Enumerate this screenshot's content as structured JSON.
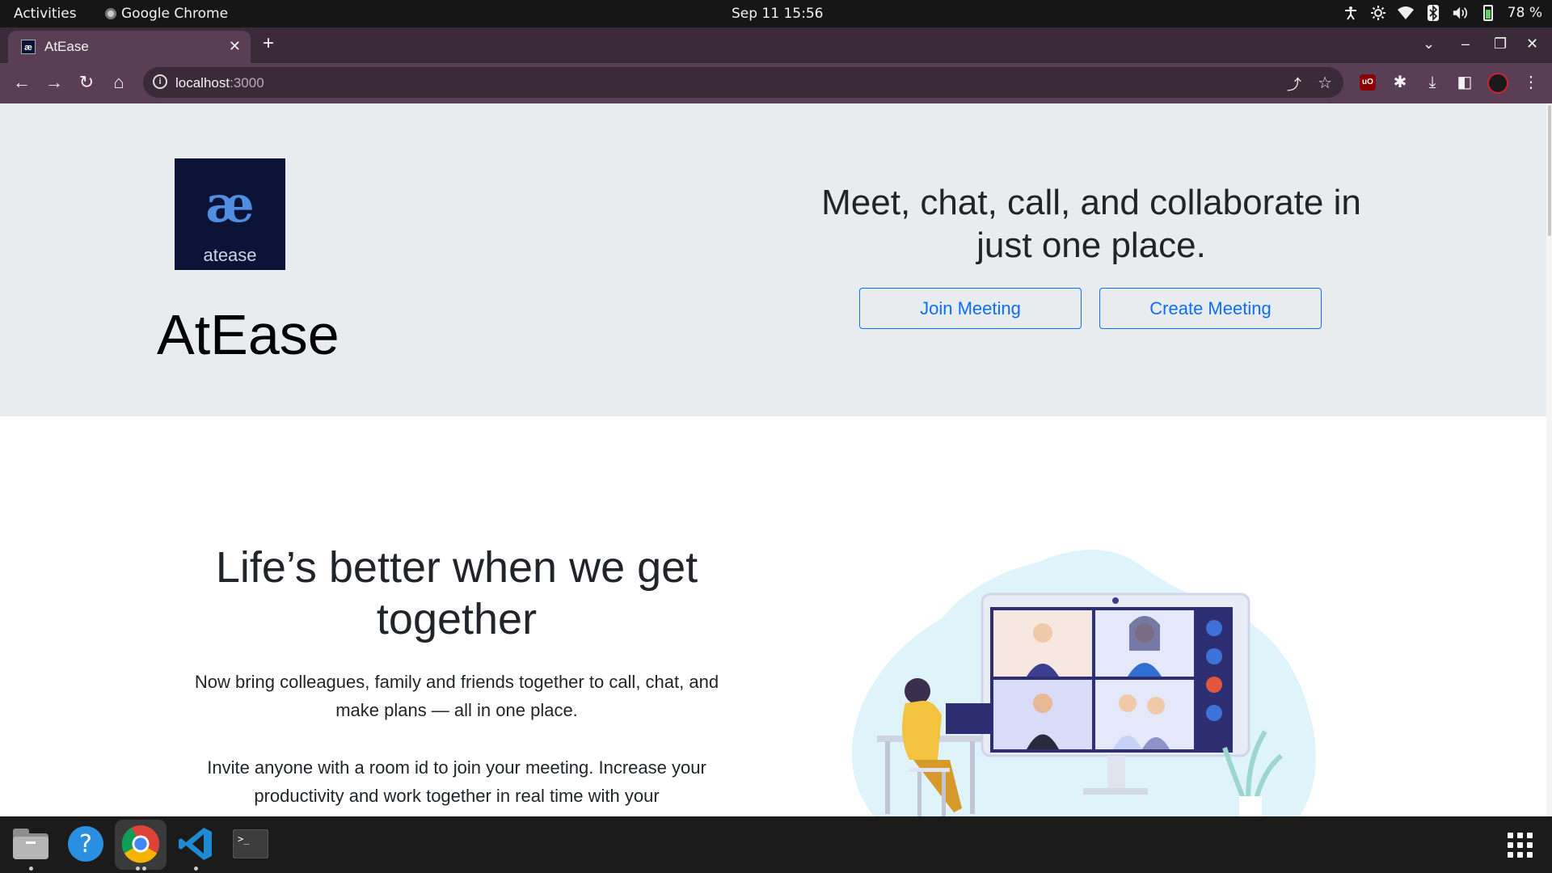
{
  "topbar": {
    "activities": "Activities",
    "app_name": "Google Chrome",
    "datetime": "Sep 11  15:56",
    "battery": "78 %"
  },
  "browser": {
    "tab_title": "AtEase",
    "tab_favicon": "æ",
    "url_host": "localhost",
    "url_port": ":3000"
  },
  "hero": {
    "logo_mark": "æ",
    "logo_word": "atease",
    "brand": "AtEase",
    "tagline": "Meet, chat, call, and collaborate in just one place.",
    "join_button": "Join Meeting",
    "create_button": "Create Meeting"
  },
  "features": {
    "title": "Life’s better when we get together",
    "paragraph1": "Now bring colleagues, family and friends together to call, chat, and make plans — all in one place.",
    "paragraph2": "Invite anyone with a room id to join your meeting. Increase your productivity and work together in real time with your"
  },
  "icons": {
    "tray": [
      "accessibility-icon",
      "brightness-icon",
      "wifi-icon",
      "bluetooth-icon",
      "volume-icon",
      "battery-icon"
    ],
    "dock": [
      "files-icon",
      "help-icon",
      "chrome-icon",
      "vscode-icon",
      "terminal-icon",
      "show-apps-icon"
    ]
  },
  "colors": {
    "accent": "#0d6efd",
    "hero_bg": "#e9ecef",
    "tab_bg": "#5a3e56",
    "logo_bg": "#0b1436"
  }
}
